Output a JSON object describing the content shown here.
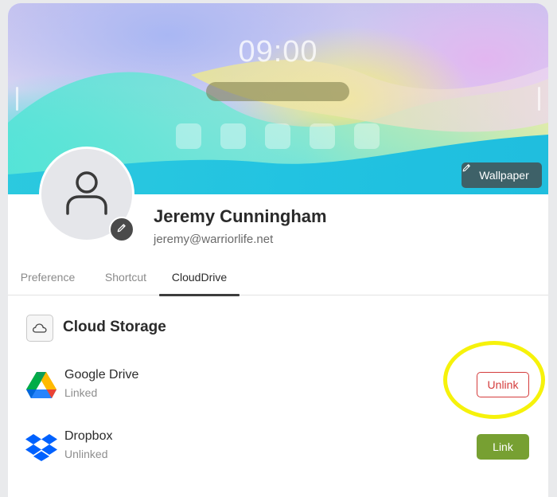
{
  "banner": {
    "time": "09:00",
    "wallpaper_label": "Wallpaper",
    "edit_icon": "pencil-icon"
  },
  "user": {
    "name": "Jeremy Cunningham",
    "email": "jeremy@warriorlife.net",
    "avatar_icon": "user-icon",
    "avatar_edit_icon": "pencil-icon"
  },
  "tabs": [
    {
      "label": "Preference",
      "active": false
    },
    {
      "label": "Shortcut",
      "active": false
    },
    {
      "label": "CloudDrive",
      "active": true
    }
  ],
  "cloud": {
    "title": "Cloud Storage",
    "icon": "cloud-icon",
    "providers": [
      {
        "name": "Google Drive",
        "status": "Linked",
        "action": "Unlink",
        "icon": "google-drive-icon"
      },
      {
        "name": "Dropbox",
        "status": "Unlinked",
        "action": "Link",
        "icon": "dropbox-icon"
      }
    ]
  },
  "colors": {
    "unlink": "#d43c3c",
    "link": "#77a032",
    "highlight": "#f6f20b",
    "tab_indicator": "#3d3d3d"
  }
}
